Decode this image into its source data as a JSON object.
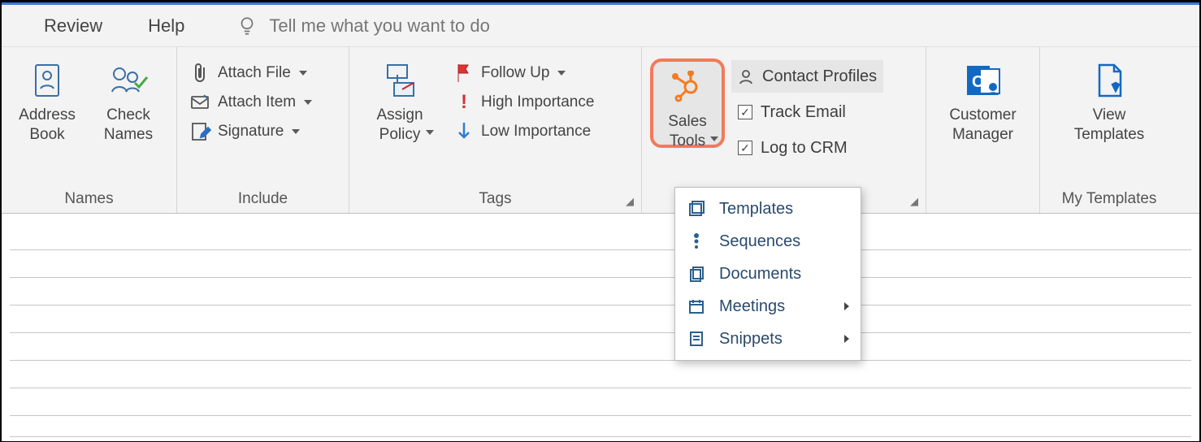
{
  "tabs": {
    "review": "Review",
    "help": "Help",
    "tell_me": "Tell me what you want to do"
  },
  "groups": {
    "names": {
      "label": "Names",
      "address_book": "Address\nBook",
      "check_names": "Check\nNames"
    },
    "include": {
      "label": "Include",
      "attach_file": "Attach File",
      "attach_item": "Attach Item",
      "signature": "Signature"
    },
    "tags": {
      "label": "Tags",
      "assign_policy": "Assign\nPolicy",
      "follow_up": "Follow Up",
      "high_importance": "High Importance",
      "low_importance": "Low Importance"
    },
    "hubspot": {
      "sales_tools": "Sales\nTools",
      "contact_profiles": "Contact Profiles",
      "track_email": "Track Email",
      "log_to_crm": "Log to CRM"
    },
    "customer_manager": "Customer\nManager",
    "my_templates": {
      "label": "My Templates",
      "view_templates": "View\nTemplates"
    }
  },
  "menu": {
    "templates": "Templates",
    "sequences": "Sequences",
    "documents": "Documents",
    "meetings": "Meetings",
    "snippets": "Snippets"
  }
}
